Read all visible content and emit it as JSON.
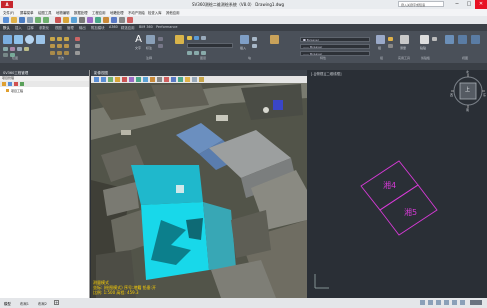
{
  "window": {
    "logo": "A",
    "title": "SV360测绘二维测绘系统（V8.0）    Drawing1.dwg",
    "search_placeholder": "键入关键字或短语",
    "minimize": "─",
    "maximize": "□",
    "close": "✕"
  },
  "menu": [
    "文件(F)",
    "屏幕菜单",
    "绘图工具",
    "地物编辑",
    "数据处理",
    "工程应用",
    "地籍处理",
    "不动产测绘",
    "检查入库",
    "其他应用"
  ],
  "ribbon_tabs": [
    "默认",
    "插入",
    "注释",
    "参数化",
    "视图",
    "管理",
    "输出",
    "附加模块",
    "A360",
    "精选应用",
    "BIM 360",
    "Performance"
  ],
  "ribbon": {
    "panels": [
      "绘图",
      "修改",
      "注释",
      "图层",
      "块",
      "特性",
      "组",
      "实用工具",
      "剪贴板",
      "视图"
    ],
    "layer_dropdown": "■ ByLayer",
    "prop_dropdown_1": "—— ByLayer",
    "prop_dropdown_2": "—— ByLayer",
    "text_label": "文字",
    "dim_label": "标注",
    "insert_label": "插入",
    "measure_label": "测量",
    "paste_label": "粘贴",
    "group_label": "组"
  },
  "left_panel": {
    "title": "SV360工程管理",
    "subtitle": "项目管理",
    "tree_root": "项目工程"
  },
  "photo_view": {
    "title": "影像视图",
    "status_lines": [
      "测量模式",
      "坐标: (绘图模式) 序号:地籍 铅垂:开",
      "比例: 1:500  高程: 459.3"
    ]
  },
  "drawing_view": {
    "title": "[-][俯视][二维线框]",
    "labels": [
      "湘4",
      "湘5"
    ],
    "viewcube_label": "上",
    "compass": {
      "n": "北",
      "s": "南",
      "e": "东",
      "w": "西"
    },
    "accent": "#d63ad6"
  },
  "statusbar": {
    "tabs": [
      "模型",
      "布局1",
      "布局2"
    ]
  },
  "colors": {
    "cyan_highlight": "#18d8ea",
    "magenta": "#d63ad6",
    "status_yellow": "#ffd200",
    "ribbon_bg": "#4a5059"
  }
}
